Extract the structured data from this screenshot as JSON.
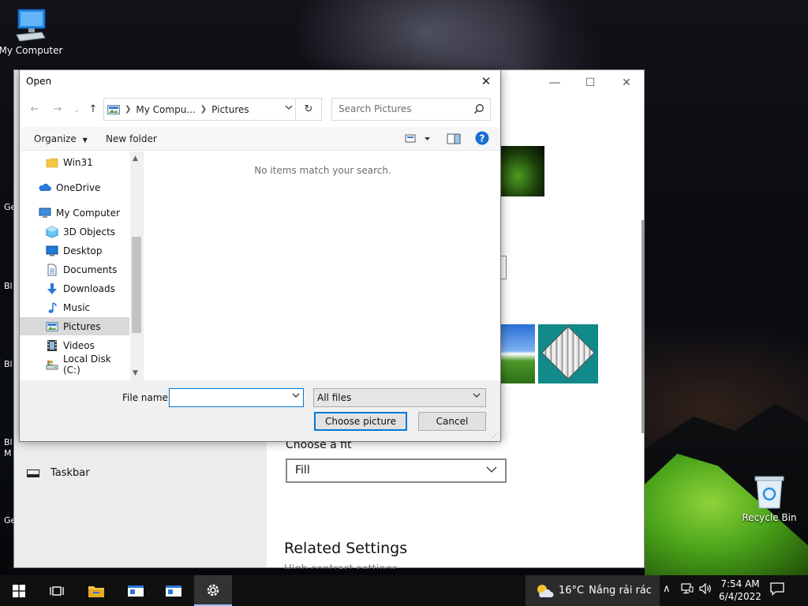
{
  "desktop": {
    "my_computer_label": "My Computer",
    "recycle_bin_label": "Recycle Bin",
    "edge_labels": [
      "Ge",
      "Bl",
      "Bl",
      "Bl",
      "M",
      "Ge"
    ]
  },
  "settings": {
    "taskbar_label": "Taskbar",
    "fit_label": "Choose a fit",
    "fit_value": "Fill",
    "related_title": "Related Settings",
    "related_sub": "High contrast settings"
  },
  "dialog": {
    "title": "Open",
    "address": {
      "seg1": "My Compu...",
      "seg2": "Pictures"
    },
    "search_placeholder": "Search Pictures",
    "toolbar": {
      "organize": "Organize",
      "new_folder": "New folder"
    },
    "nav_items": [
      {
        "label": "Win31",
        "icon": "folder-icon"
      },
      {
        "label": "OneDrive",
        "icon": "cloud-icon"
      },
      {
        "label": "My Computer",
        "icon": "computer-icon"
      },
      {
        "label": "3D Objects",
        "icon": "cube-icon"
      },
      {
        "label": "Desktop",
        "icon": "desktop-icon"
      },
      {
        "label": "Documents",
        "icon": "document-icon"
      },
      {
        "label": "Downloads",
        "icon": "download-icon"
      },
      {
        "label": "Music",
        "icon": "music-icon"
      },
      {
        "label": "Pictures",
        "icon": "pictures-icon"
      },
      {
        "label": "Videos",
        "icon": "film-icon"
      },
      {
        "label": "Local Disk (C:)",
        "icon": "drive-icon"
      }
    ],
    "empty_message": "No items match your search.",
    "file_name_label": "File name:",
    "file_name_value": "",
    "file_type": "All files",
    "choose_button": "Choose picture",
    "cancel_button": "Cancel"
  },
  "taskbar": {
    "weather_temp": "16°C",
    "weather_text": "Nắng rải rác",
    "time": "7:54 AM",
    "date": "6/4/2022"
  },
  "colors": {
    "accent": "#0078d7",
    "folder": "#f5c445",
    "onedrive": "#2b78d7"
  }
}
